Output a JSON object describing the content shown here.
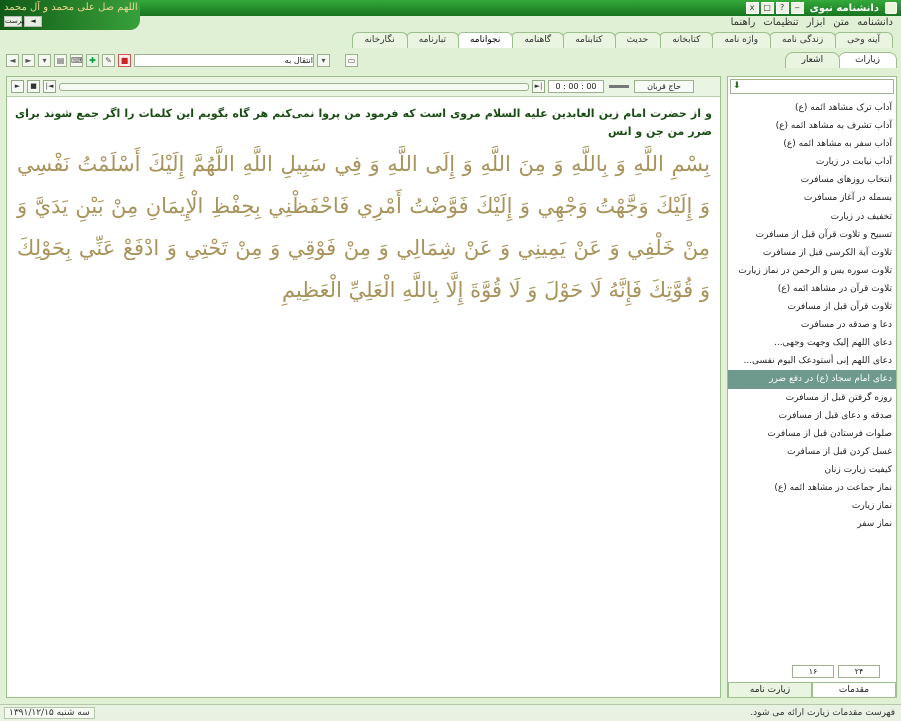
{
  "window": {
    "title": "دانشنامه نبوی"
  },
  "banner": {
    "text": "اللهم صل علی محمد و آل محمد",
    "buttons": [
      "فهرست",
      "◄"
    ]
  },
  "window_buttons": [
    "‒",
    "?",
    "□",
    "x"
  ],
  "menu": [
    "دانشنامه",
    "متن",
    "ابزار",
    "تنظیمات",
    "راهنما"
  ],
  "top_tabs": [
    "آینه وحی",
    "زندگی نامه",
    "واژه نامه",
    "کتابخانه",
    "حدیث",
    "کتابنامه",
    "گاهنامه",
    "نجوانامه",
    "تبارنامه",
    "نگارخانه"
  ],
  "active_top_tab": "نجوانامه",
  "toolbar": {
    "goto_label": "انتقال به",
    "icons": [
      "back-icon",
      "forward-icon",
      "down-icon",
      "print-icon",
      "keyboard-icon",
      "plugin-icon",
      "edit-icon",
      "pdf-icon"
    ]
  },
  "right_tabs": [
    "زیارات",
    "اشعار"
  ],
  "active_right_tab": "زیارات",
  "player": {
    "time": "0 : 00 : 00",
    "reciter": "حاج قربان"
  },
  "content": {
    "intro": "و از حضرت امام زین العابدین علیه السلام مروی است که فرمود من پروا نمی‌کنم هر گاه بگویم این کلمات را اگر جمع شوند برای ضرر من جن و انس",
    "arabic": "بِسْمِ اللَّهِ وَ بِاللَّهِ وَ مِنَ اللَّهِ وَ إِلَى اللَّهِ وَ فِي سَبِيلِ اللَّهِ اللَّهُمَّ إِلَيْكَ أَسْلَمْتُ نَفْسِي وَ إِلَيْكَ وَجَّهْتُ وَجْهِي وَ إِلَيْكَ فَوَّضْتُ أَمْرِي فَاحْفَظْنِي بِحِفْظِ الْإِيمَانِ مِنْ بَيْنِ يَدَيَّ وَ مِنْ خَلْفِي وَ عَنْ يَمِينِي وَ عَنْ شِمَالِي وَ مِنْ فَوْقِي وَ مِنْ تَحْتِي وَ ادْفَعْ عَنِّي بِحَوْلِكَ وَ قُوَّتِكَ فَإِنَّهُ لَا حَوْلَ وَ لَا قُوَّةَ إِلَّا بِاللَّهِ الْعَلِيِّ الْعَظِيمِ"
  },
  "sidebar": {
    "items": [
      "آداب ترک مشاهد ائمه (ع)",
      "آداب تشرف به مشاهد ائمه (ع)",
      "آداب سفر به مشاهد ائمه (ع)",
      "آداب نیابت در زیارت",
      "انتخاب روزهای مسافرت",
      "بسمله در آغاز مسافرت",
      "تخفیف در زیارت",
      "تسبیح و تلاوت قرآن قبل از مسافرت",
      "تلاوت آیة الکرسی قبل از مسافرت",
      "تلاوت سوره یس و الرحمن در نماز زیارت",
      "تلاوت قرآن در مشاهد ائمه (ع)",
      "تلاوت قرآن قبل از مسافرت",
      "دعا و صدقه در مسافرت",
      "دعای اللهم إلیک وجهت وجهی...",
      "دعای اللهم إنی أستودعک الیوم نفسی...",
      "دعای امام سجاد (ع) در دفع ضرر",
      "روزه گرفتن قبل از مسافرت",
      "صدقه و دعای قبل از مسافرت",
      "صلوات فرستادن قبل از مسافرت",
      "غسل کردن قبل از مسافرت",
      "کیفیت زیارت زنان",
      "نماز جماعت در مشاهد ائمه (ع)",
      "نماز زیارت",
      "نماز سفر"
    ],
    "selected_index": 15,
    "pager": {
      "current": "۱۶",
      "total": "۲۴"
    },
    "bottom_tabs": [
      "مقدمات",
      "زیارت نامه"
    ],
    "active_bottom_tab": "مقدمات"
  },
  "status": {
    "message": "فهرست مقدمات زیارت ارائه می شود.",
    "date": "سه شنبه ۱۳۹۱/۱۲/۱۵"
  }
}
